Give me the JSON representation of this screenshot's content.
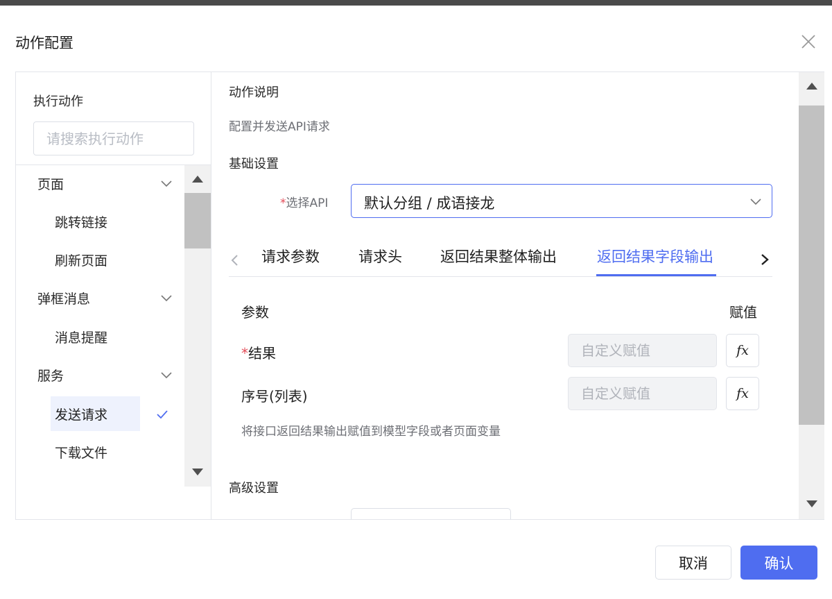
{
  "dialog": {
    "title": "动作配置"
  },
  "left_panel": {
    "header": "执行动作",
    "search_placeholder": "请搜索执行动作",
    "tree": [
      {
        "label": "页面",
        "type": "group",
        "expanded": true
      },
      {
        "label": "跳转链接",
        "type": "child"
      },
      {
        "label": "刷新页面",
        "type": "child"
      },
      {
        "label": "弹框消息",
        "type": "group",
        "expanded": true
      },
      {
        "label": "消息提醒",
        "type": "child"
      },
      {
        "label": "服务",
        "type": "group",
        "expanded": true
      },
      {
        "label": "发送请求",
        "type": "child",
        "selected": true
      },
      {
        "label": "下载文件",
        "type": "child"
      }
    ]
  },
  "right_panel": {
    "action_desc_title": "动作说明",
    "action_desc": "配置并发送API请求",
    "basic_settings_title": "基础设置",
    "api_label": "选择API",
    "api_required_mark": "*",
    "api_value": "默认分组 / 成语接龙",
    "tabs": [
      {
        "label": "请求参数",
        "active": false
      },
      {
        "label": "请求头",
        "active": false
      },
      {
        "label": "返回结果整体输出",
        "active": false
      },
      {
        "label": "返回结果字段输出",
        "active": true
      }
    ],
    "param_table": {
      "col_param": "参数",
      "col_assign": "赋值",
      "rows": [
        {
          "label": "结果",
          "required": true,
          "required_mark": "*",
          "placeholder": "自定义赋值",
          "fx": "fx"
        },
        {
          "label": "序号(列表)",
          "required": false,
          "required_mark": "",
          "placeholder": "自定义赋值",
          "fx": "fx"
        }
      ]
    },
    "hint": "将接口返回结果输出赋值到模型字段或者页面变量",
    "advanced_settings_title": "高级设置"
  },
  "footer": {
    "cancel_label": "取消",
    "ok_label": "确认"
  },
  "colors": {
    "accent": "#4f6df0",
    "required": "#e34d59",
    "selected_bg": "#eef2fd"
  },
  "icons": [
    "close-icon",
    "chevron-down-icon",
    "check-icon",
    "chevron-left-icon",
    "chevron-right-icon",
    "scroll-up-arrow-icon",
    "scroll-down-arrow-icon"
  ]
}
